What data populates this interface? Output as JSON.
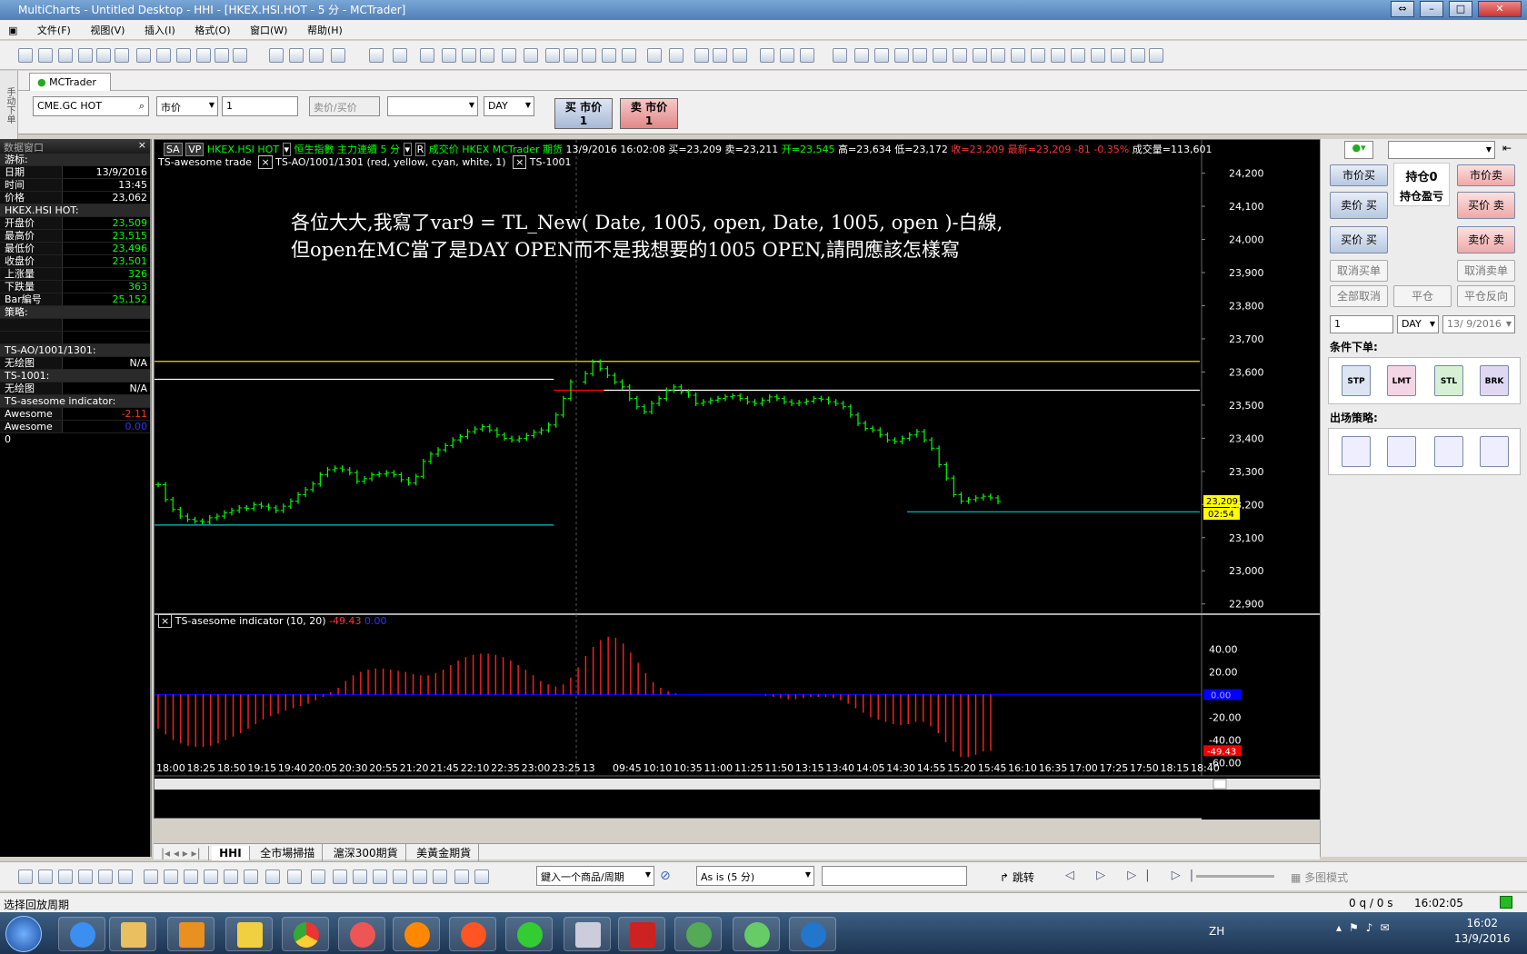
{
  "window": {
    "title": "MultiCharts - Untitled Desktop - HHI - [HKEX.HSI.HOT - 5 分 - MCTrader]"
  },
  "menu": [
    "文件(F)",
    "视图(V)",
    "插入(I)",
    "格式(O)",
    "窗口(W)",
    "帮助(H)"
  ],
  "side_label": "手动下单",
  "mctrader_tab": "MCTrader",
  "order": {
    "symbol": "CME.GC HOT",
    "order_type": "市价",
    "qty": "1",
    "price_placeholder": "卖价/买价",
    "account": "",
    "tif": "DAY",
    "buy_label": "买 市价",
    "buy_qty": "1",
    "sell_label": "卖 市价",
    "sell_qty": "1"
  },
  "data_window": {
    "title": "数据窗口",
    "rows": [
      {
        "k": "游标:",
        "v": "",
        "sec": true
      },
      {
        "k": "日期",
        "v": "13/9/2016"
      },
      {
        "k": "时间",
        "v": "13:45"
      },
      {
        "k": "价格",
        "v": "23,062"
      },
      {
        "k": "HKEX.HSI HOT:",
        "v": "",
        "sec": true
      },
      {
        "k": "开盘价",
        "v": "23,509",
        "c": "#0f0"
      },
      {
        "k": "最高价",
        "v": "23,515",
        "c": "#0f0"
      },
      {
        "k": "最低价",
        "v": "23,496",
        "c": "#0f0"
      },
      {
        "k": "收盘价",
        "v": "23,501",
        "c": "#0f0"
      },
      {
        "k": "上涨量",
        "v": "326",
        "c": "#0f0"
      },
      {
        "k": "下跌量",
        "v": "363",
        "c": "#0f0"
      },
      {
        "k": "Bar編号",
        "v": "25,152",
        "c": "#0f0"
      },
      {
        "k": "策略:",
        "v": "",
        "sec": true
      },
      {
        "k": "",
        "v": ""
      },
      {
        "k": "",
        "v": ""
      },
      {
        "k": "TS-AO/1001/1301:",
        "v": "",
        "sec": true
      },
      {
        "k": "无绘图",
        "v": "N/A"
      },
      {
        "k": "TS-1001:",
        "v": "",
        "sec": true
      },
      {
        "k": "无绘图",
        "v": "N/A"
      },
      {
        "k": "TS-asesome indicator:",
        "v": "",
        "sec": true
      },
      {
        "k": "Awesome",
        "v": "-2.11",
        "c": "#f33"
      },
      {
        "k": "Awesome 0",
        "v": "0.00",
        "c": "#33f"
      }
    ]
  },
  "chart_header": {
    "sa": "SA",
    "vp": "VP",
    "symbol": "HKEX.HSI HOT",
    "name": "恒生指數 主力連續 5 分",
    "r": "R",
    "traded": "成交价",
    "exch": "HKEX MCTrader 期货",
    "date": "13/9/2016",
    "time": "16:02:08",
    "bid": "买=23,209",
    "ask": "卖=23,211",
    "open": "开=23,545",
    "high": "高=23,634",
    "low": "低=23,172",
    "close": "收=23,209",
    "last": "最新=23,209",
    "chg": "-81",
    "pct": "-0.35%",
    "vol": "成交量=113,601",
    "study1": "TS-awesome trade",
    "study2": "TS-AO/1001/1301",
    "study2_params": "(red,  yellow,  cyan,  white,  1)",
    "study3": "TS-1001",
    "ind_name": "TS-asesome indicator",
    "ind_params": "(10,  20)",
    "ind_v1": "-49.43",
    "ind_v2": "0.00"
  },
  "annotation": {
    "line1": "各位大大,我寫了var9 = TL_New( Date, 1005, open, Date, 1005, open )-白線,",
    "line2": "但open在MC當了是DAY OPEN而不是我想要的1005 OPEN,請問應該怎樣寫"
  },
  "colors": {
    "up": "#00ff00",
    "down": "#00ff00",
    "hist": "#ff2020",
    "zero": "#0000ff",
    "yellow": "#e0e000",
    "cyan": "#00c8c8",
    "white": "#ffffff",
    "redline": "#ff0000"
  },
  "chart_data": [
    {
      "type": "bar",
      "title": "",
      "price_axis": [
        "24,200",
        "24,100",
        "24,000",
        "23,900",
        "23,800",
        "23,700",
        "23,600",
        "23,500",
        "23,400",
        "23,300",
        "23,200",
        "23,100",
        "23,000",
        "22,900"
      ],
      "ylim": [
        22880,
        24240
      ],
      "closes": [
        23260,
        23215,
        23185,
        23165,
        23155,
        23150,
        23148,
        23160,
        23165,
        23175,
        23182,
        23190,
        23188,
        23200,
        23195,
        23190,
        23182,
        23195,
        23210,
        23230,
        23245,
        23262,
        23290,
        23305,
        23310,
        23305,
        23296,
        23270,
        23278,
        23290,
        23292,
        23296,
        23290,
        23275,
        23265,
        23285,
        23330,
        23352,
        23365,
        23378,
        23395,
        23405,
        23420,
        23428,
        23435,
        23425,
        23410,
        23400,
        23395,
        23400,
        23408,
        23418,
        23425,
        23440,
        23470,
        23520,
        23570,
        23595,
        23630,
        23610,
        23590,
        23570,
        23555,
        23520,
        23495,
        23480,
        23505,
        23520,
        23545,
        23555,
        23540,
        23530,
        23505,
        23510,
        23515,
        23520,
        23525,
        23528,
        23520,
        23510,
        23505,
        23515,
        23525,
        23520,
        23510,
        23505,
        23508,
        23512,
        23520,
        23518,
        23510,
        23505,
        23495,
        23470,
        23445,
        23430,
        23425,
        23410,
        23395,
        23390,
        23400,
        23410,
        23420,
        23395,
        23370,
        23320,
        23280,
        23230,
        23210,
        23215,
        23220,
        23225,
        23220,
        23209
      ],
      "hlines": [
        {
          "name": "yellow",
          "y": 23632,
          "from": 0.0,
          "to": 1.0
        },
        {
          "name": "white",
          "y": 23578,
          "from": 0.0,
          "to": 0.382
        },
        {
          "name": "cyan",
          "y": 23138,
          "from": 0.0,
          "to": 0.382
        },
        {
          "name": "redline",
          "y": 23545,
          "from": 0.382,
          "to": 0.43
        },
        {
          "name": "white",
          "y": 23545,
          "from": 0.43,
          "to": 1.0
        },
        {
          "name": "cyan",
          "y": 23178,
          "from": 0.72,
          "to": 1.0
        }
      ],
      "last_tags": [
        "23,209",
        "02:54"
      ],
      "x_ticks": [
        "18:00",
        "18:25",
        "18:50",
        "19:15",
        "19:40",
        "20:05",
        "20:30",
        "20:55",
        "21:20",
        "21:45",
        "22:10",
        "22:35",
        "23:00",
        "23:25",
        "13",
        "09:45",
        "10:10",
        "10:35",
        "11:00",
        "11:25",
        "11:50",
        "13:15",
        "13:40",
        "14:05",
        "14:30",
        "14:55",
        "15:20",
        "15:45",
        "16:10",
        "16:35",
        "17:00",
        "17:25",
        "17:50",
        "18:15",
        "18:40"
      ]
    },
    {
      "type": "bar",
      "title": "",
      "ind_axis": [
        "40.00",
        "20.00",
        "0.00",
        "-20.00",
        "-40.00",
        "-60.00"
      ],
      "ylim": [
        -62,
        58
      ],
      "last_tag": "-49.43",
      "values": [
        -30,
        -35,
        -40,
        -43,
        -45,
        -46,
        -46,
        -45,
        -43,
        -40,
        -37,
        -34,
        -30,
        -26,
        -22,
        -19,
        -17,
        -14,
        -12,
        -10,
        -8,
        -5,
        -2,
        2,
        6,
        12,
        17,
        20,
        22,
        23,
        23,
        22,
        21,
        20,
        18,
        17,
        17,
        19,
        22,
        26,
        30,
        33,
        35,
        36,
        36,
        35,
        33,
        30,
        26,
        22,
        17,
        12,
        9,
        7,
        9,
        15,
        24,
        34,
        42,
        48,
        51,
        50,
        45,
        37,
        28,
        19,
        11,
        6,
        3,
        1,
        0,
        0,
        0,
        0,
        0,
        0,
        0,
        0,
        0,
        0,
        0,
        -1,
        -2,
        -3,
        -4,
        -4,
        -3,
        -2,
        -2,
        -2,
        -3,
        -5,
        -8,
        -12,
        -16,
        -20,
        -22,
        -24,
        -26,
        -27,
        -26,
        -24,
        -24,
        -28,
        -34,
        -42,
        -50,
        -55,
        -55,
        -53,
        -50,
        -49.43
      ]
    }
  ],
  "sheets": [
    "HHI",
    "全市場掃描",
    "滬深300期貨",
    "美黃金期貨"
  ],
  "right_panel": {
    "mkt_buy": "市价买",
    "position": "持仓0",
    "pnl": "持仓盈亏",
    "mkt_sell": "市价卖",
    "ask_buy": "卖价 买",
    "bid_sell": "买价 卖",
    "bid_buy": "买价 买",
    "ask_sell": "卖价 卖",
    "cancel_buy": "取消买单",
    "cancel_sell": "取消卖单",
    "cancel_all": "全部取消",
    "flatten": "平仓",
    "reverse": "平仓反向",
    "qty": "1",
    "tif": "DAY",
    "date": "13/ 9/2016",
    "cond_label": "条件下单:",
    "exit_label": "出场策略:",
    "cond_icons": [
      "STP",
      "LMT",
      "STL",
      "BRK"
    ]
  },
  "drawbar": {
    "symbol_input": "鍵入一个商品/周期",
    "resolution": "As is (5 分)",
    "jump": "跳转",
    "multi": "多图模式"
  },
  "status": {
    "left": "选择回放周期",
    "q": "0 q / 0 s",
    "time": "16:02:05"
  },
  "taskbar": {
    "lang": "ZH",
    "time": "16:02",
    "date": "13/9/2016"
  }
}
